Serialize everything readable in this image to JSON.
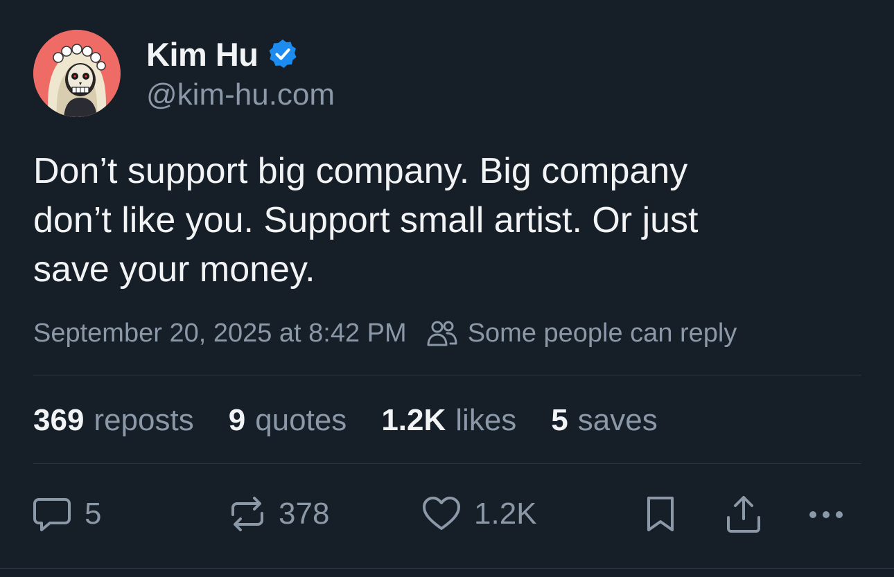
{
  "author": {
    "display_name": "Kim Hu",
    "handle": "@kim-hu.com",
    "verified": true,
    "avatar_icon": "skull-with-flower-crown-avatar",
    "verified_icon": "verified-check-icon",
    "accent_color": "#1d8cf0"
  },
  "post": {
    "text": "Don’t support big company. Big company\ndon’t like you. Support small artist. Or just\nsave your money.",
    "timestamp": "September 20, 2025 at 8:42 PM",
    "reply_scope": "Some people can reply",
    "reply_scope_icon": "people-icon"
  },
  "stats": [
    {
      "value": "369",
      "label": "reposts"
    },
    {
      "value": "9",
      "label": "quotes"
    },
    {
      "value": "1.2K",
      "label": "likes"
    },
    {
      "value": "5",
      "label": "saves"
    }
  ],
  "actions": {
    "reply": {
      "icon": "reply-bubble-icon",
      "count": "5"
    },
    "repost": {
      "icon": "repost-icon",
      "count": "378"
    },
    "like": {
      "icon": "heart-icon",
      "count": "1.2K"
    },
    "save": {
      "icon": "bookmark-icon"
    },
    "share": {
      "icon": "share-icon"
    },
    "more": {
      "icon": "more-dots-icon"
    }
  },
  "colors": {
    "background": "#161e27",
    "text_primary": "#f1f3f5",
    "text_secondary": "#8b98a8",
    "divider": "#2c3845"
  }
}
